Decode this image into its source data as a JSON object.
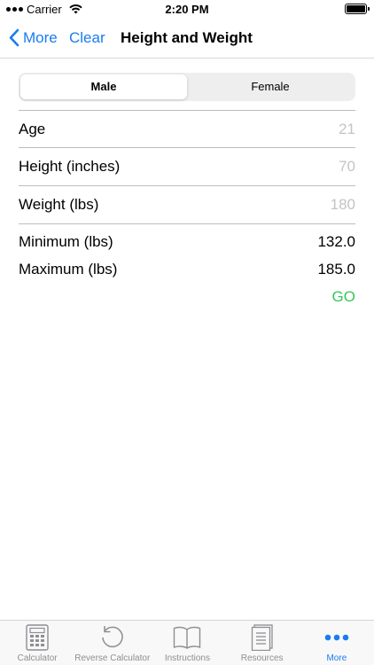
{
  "status": {
    "carrier": "Carrier",
    "time": "2:20 PM"
  },
  "nav": {
    "back_label": "More",
    "clear_label": "Clear",
    "title": "Height and Weight"
  },
  "gender": {
    "options": [
      "Male",
      "Female"
    ],
    "selected": "Male"
  },
  "fields": [
    {
      "label": "Age",
      "placeholder": "21"
    },
    {
      "label": "Height (inches)",
      "placeholder": "70"
    },
    {
      "label": "Weight (lbs)",
      "placeholder": "180"
    }
  ],
  "results": [
    {
      "label": "Minimum (lbs)",
      "value": "132.0"
    },
    {
      "label": "Maximum (lbs)",
      "value": "185.0"
    }
  ],
  "go_label": "GO",
  "tabs": [
    {
      "label": "Calculator",
      "icon": "calculator-icon"
    },
    {
      "label": "Reverse Calculator",
      "icon": "reverse-icon"
    },
    {
      "label": "Instructions",
      "icon": "book-icon"
    },
    {
      "label": "Resources",
      "icon": "document-icon"
    },
    {
      "label": "More",
      "icon": "more-icon"
    }
  ],
  "active_tab": "More",
  "colors": {
    "accent": "#1a7cf0",
    "go": "#34c759",
    "placeholder": "#c4c4c6"
  }
}
